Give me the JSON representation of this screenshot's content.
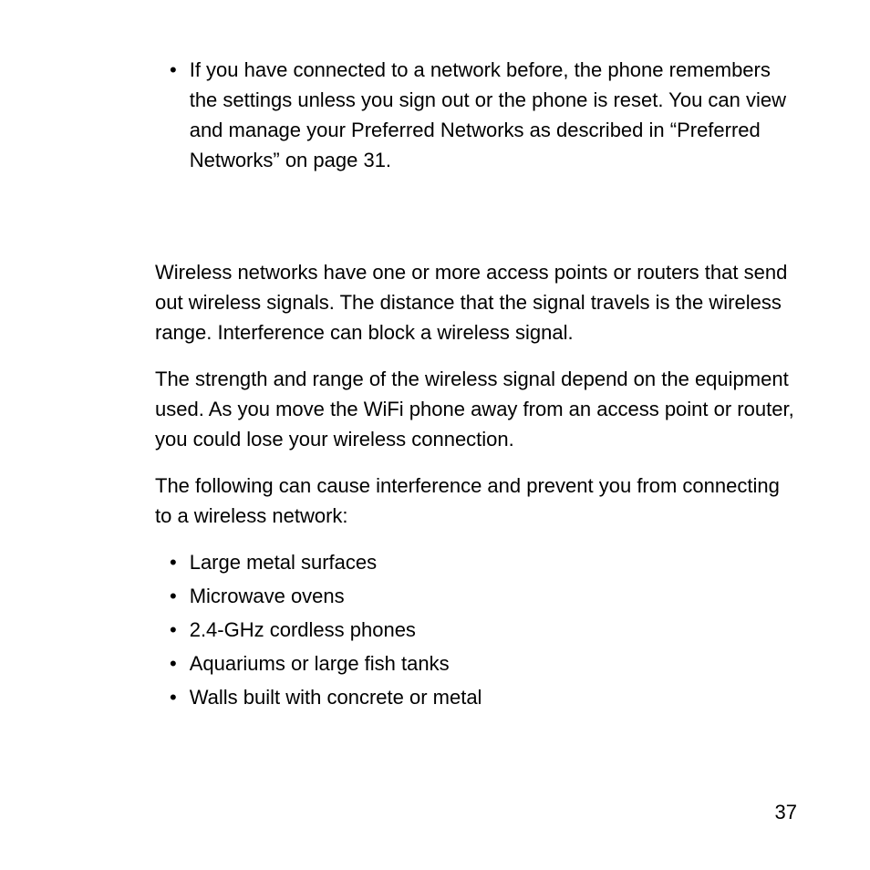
{
  "intro_bullet": "If you have connected to a network before, the phone remembers the settings unless you sign out or the phone is reset. You can view and manage your Preferred Networks as described in “Preferred Networks” on page 31.",
  "para1": "Wireless networks have one or more access points or routers that send out wireless signals. The distance that the signal travels is the wireless range. Interference can block a wireless signal.",
  "para2": "The strength and range of the wireless signal depend on the equipment used. As you move the WiFi phone away from an access point or router, you could lose your wireless connection.",
  "para3": "The following can cause interference and prevent you from connecting to a wireless network:",
  "interference_items": {
    "0": "Large metal surfaces",
    "1": "Microwave ovens",
    "2": "2.4-GHz cordless phones",
    "3": "Aquariums or large fish tanks",
    "4": "Walls built with concrete or metal"
  },
  "page_number": "37"
}
